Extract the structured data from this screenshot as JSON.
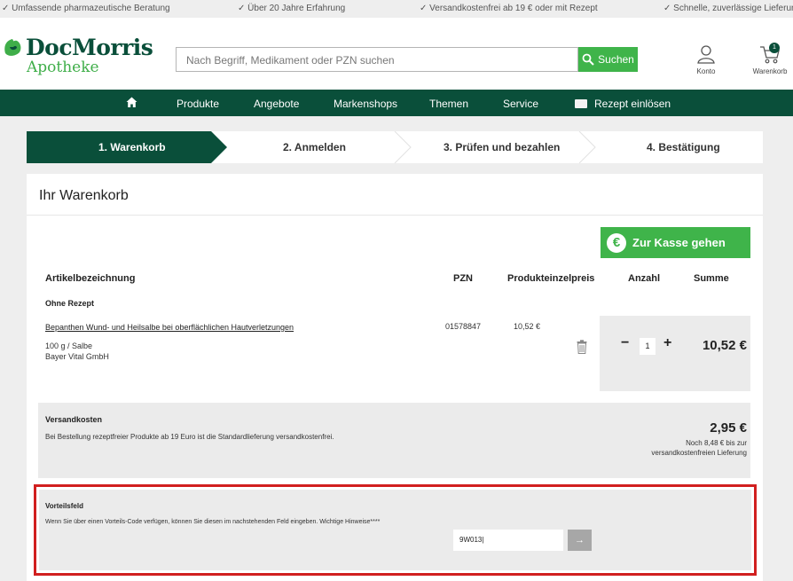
{
  "topbar": {
    "items": [
      "✓ Umfassende pharmazeutische Beratung",
      "✓ Über 20 Jahre Erfahrung",
      "✓ Versandkostenfrei ab 19 € oder mit Rezept",
      "✓ Schnelle, zuverlässige Lieferung"
    ]
  },
  "header": {
    "logo": {
      "line1": "DocMorris",
      "line2": "Apotheke"
    },
    "search": {
      "placeholder": "Nach Begriff, Medikament oder PZN suchen",
      "button_label": "Suchen"
    },
    "account_label": "Konto",
    "cart_label": "Warenkorb",
    "cart_count": "1"
  },
  "nav": {
    "items": [
      "Produkte",
      "Angebote",
      "Markenshops",
      "Themen",
      "Service"
    ],
    "prescription_label": "Rezept einlösen"
  },
  "steps": [
    "1. Warenkorb",
    "2. Anmelden",
    "3. Prüfen und bezahlen",
    "4. Bestätigung"
  ],
  "cart": {
    "title": "Ihr Warenkorb",
    "checkout_label": "Zur Kasse gehen",
    "columns": {
      "article": "Artikelbezeichnung",
      "pzn": "PZN",
      "unit_price": "Produkteinzelpreis",
      "quantity": "Anzahl",
      "sum": "Summe"
    },
    "category": "Ohne Rezept",
    "items": [
      {
        "name": "Bepanthen Wund- und Heilsalbe bei oberflächlichen Hautverletzungen",
        "size": "100 g / Salbe",
        "maker": "Bayer Vital GmbH",
        "pzn": "01578847",
        "unit_price": "10,52 €",
        "quantity": "1",
        "sum": "10,52 €"
      }
    ],
    "shipping": {
      "title": "Versandkosten",
      "text": "Bei Bestellung rezeptfreier Produkte ab 19 Euro ist die Standardlieferung versandkostenfrei.",
      "price": "2,95 €",
      "note": "Noch 8,48 € bis zur versandkostenfreien Lieferung"
    },
    "voucher": {
      "title": "Vorteilsfeld",
      "text": "Wenn Sie über einen Vorteils-Code verfügen, können Sie diesen im nachstehenden Feld eingeben. Wichtige Hinweise****",
      "value": "9W013|",
      "submit_glyph": "→"
    }
  },
  "colors": {
    "brand_dark": "#0a4f3a",
    "brand_green": "#3fb44a",
    "highlight_red": "#d11f1f"
  }
}
